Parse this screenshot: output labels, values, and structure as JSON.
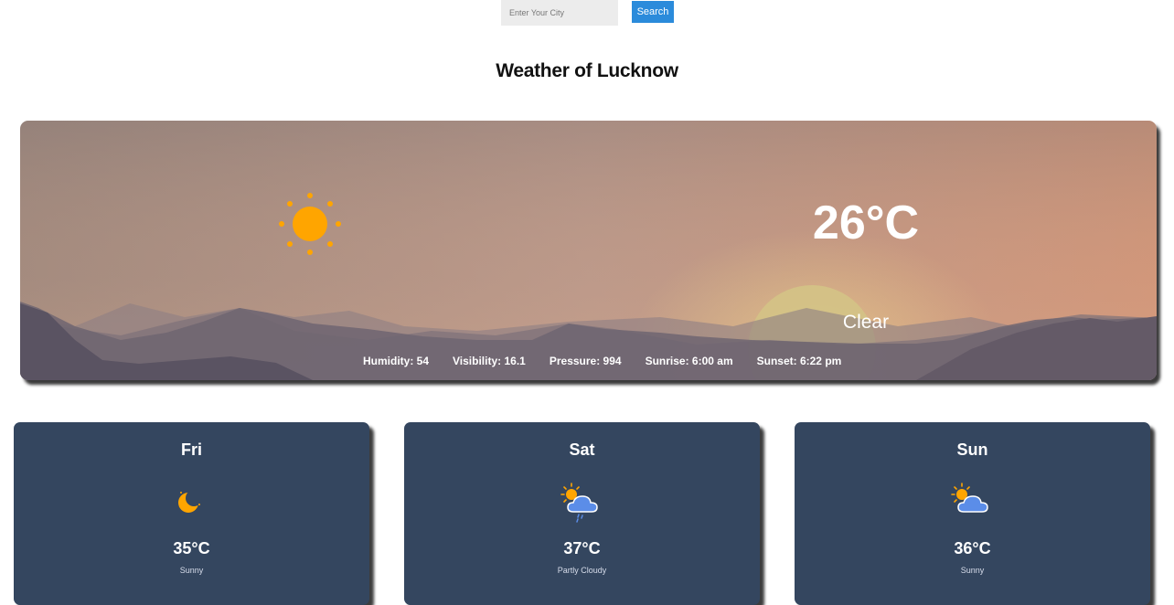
{
  "search": {
    "placeholder": "Enter Your City",
    "button_label": "Search"
  },
  "page_title": "Weather of Lucknow",
  "current": {
    "icon": "sun-icon",
    "temperature": "26°C",
    "condition": "Clear",
    "stats": {
      "humidity": "Humidity: 54",
      "visibility": "Visibility: 16.1",
      "pressure": "Pressure: 994",
      "sunrise": "Sunrise: 6:00 am",
      "sunset": "Sunset: 6:22 pm"
    }
  },
  "forecast": [
    {
      "day": "Fri",
      "icon": "moon-icon",
      "temperature": "35°C",
      "description": "Sunny"
    },
    {
      "day": "Sat",
      "icon": "sun-cloud-rain-icon",
      "temperature": "37°C",
      "description": "Partly Cloudy"
    },
    {
      "day": "Sun",
      "icon": "sun-cloud-icon",
      "temperature": "36°C",
      "description": "Sunny"
    }
  ],
  "colors": {
    "search_button": "#2b8bdb",
    "card_background": "#34465f",
    "sun": "#ffa500",
    "cloud": "#5b8de8"
  }
}
